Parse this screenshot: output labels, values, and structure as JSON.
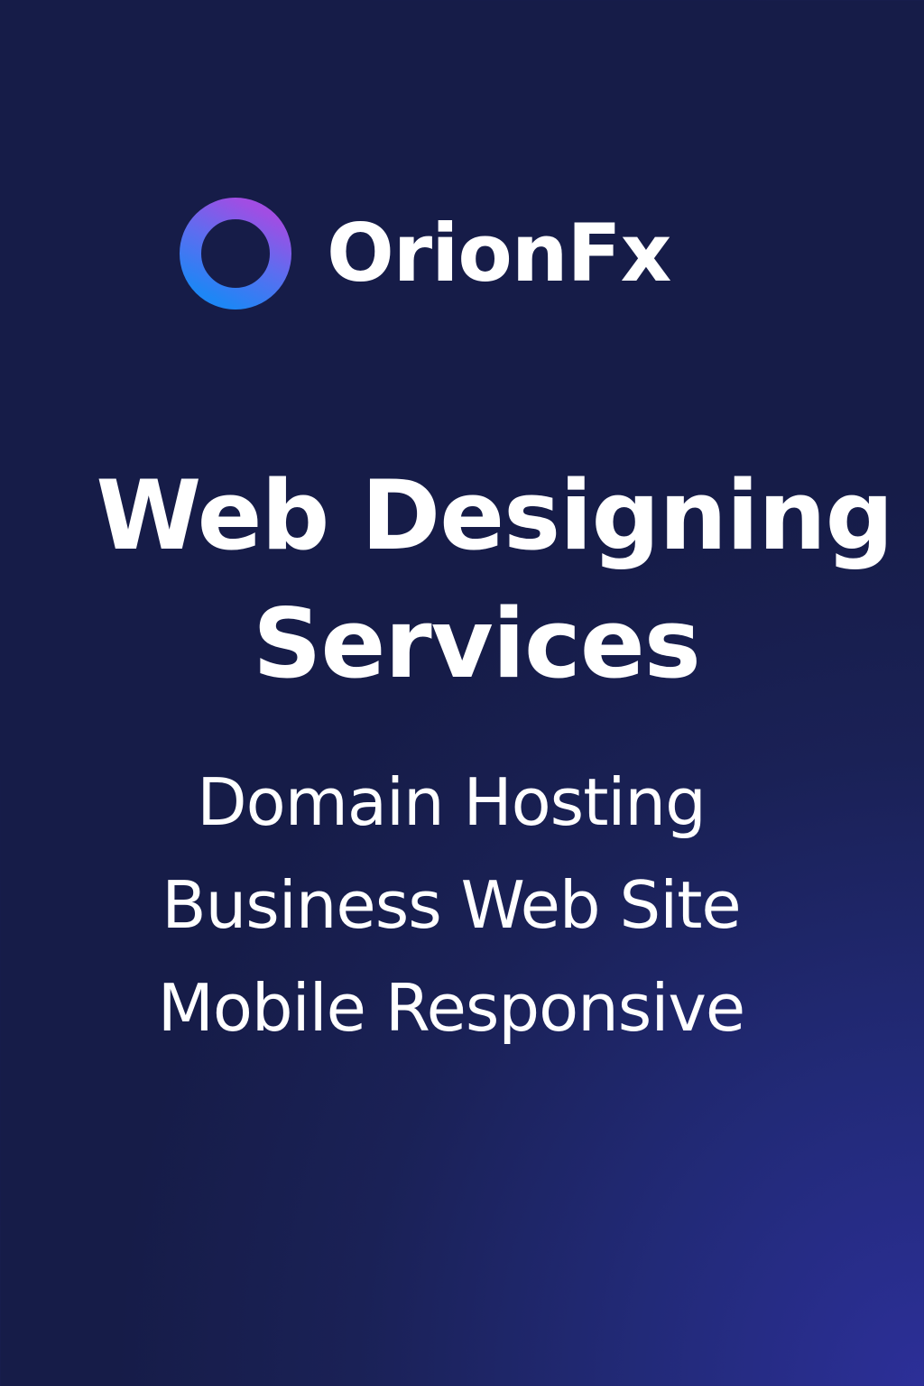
{
  "brand": {
    "name": "OrionFx",
    "logo_icon": "ring-logo-icon",
    "logo_gradient": [
      "#a14de3",
      "#5b6ef0",
      "#1e86f5"
    ]
  },
  "headline": {
    "line1": "Web Designing",
    "line2": "Services"
  },
  "services": {
    "items": [
      "Domain Hosting",
      "Business Web Site",
      "Mobile Responsive"
    ]
  },
  "colors": {
    "background_top": "#161c48",
    "background_bottom_right": "#2c2f98",
    "text": "#ffffff"
  }
}
